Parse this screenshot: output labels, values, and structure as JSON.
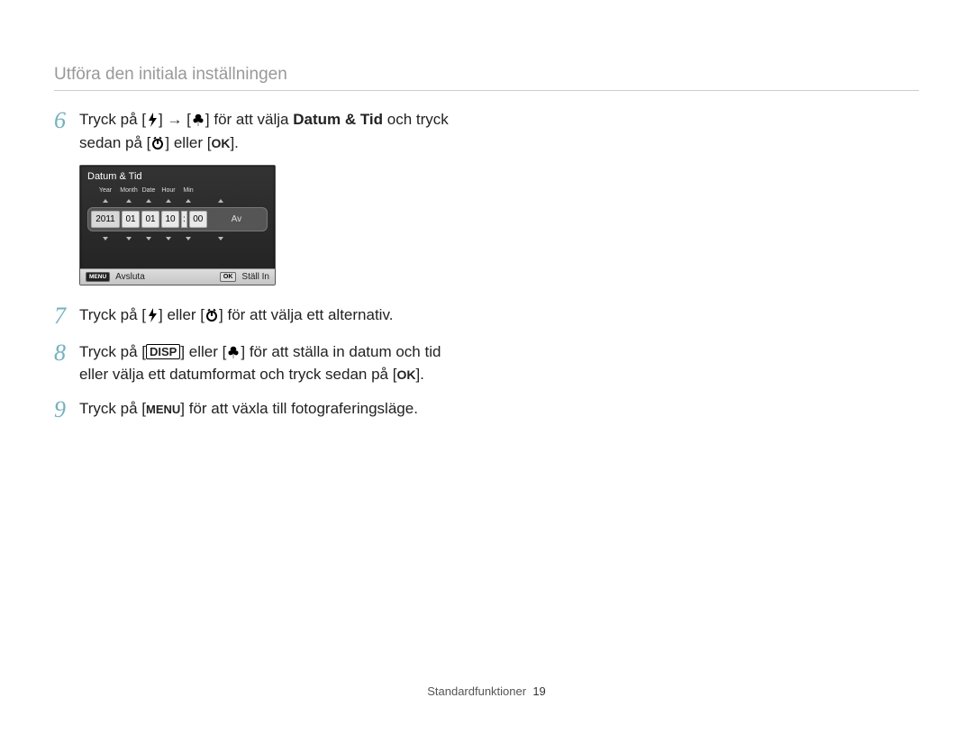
{
  "header": {
    "title": "Utföra den initiala inställningen"
  },
  "icons": {
    "flash": "flash-icon",
    "macro": "macro-icon",
    "timer": "self-timer-icon",
    "arrow_right": "→"
  },
  "steps": {
    "s6": {
      "num": "6",
      "t1": "Tryck på [",
      "t2": "] ",
      "t3": " [",
      "t4": "] för att välja ",
      "bold": "Datum & Tid",
      "t5": " och tryck",
      "t6": "sedan på [",
      "t7": "] eller [",
      "ok": "OK",
      "t8": "]."
    },
    "s7": {
      "num": "7",
      "t1": "Tryck på [",
      "t2": "] eller [",
      "t3": "] för att välja ett alternativ."
    },
    "s8": {
      "num": "8",
      "t1": "Tryck på [",
      "disp": "DISP",
      "t2": "] eller [",
      "t3": "] för att ställa in datum och tid",
      "t4": "eller välja ett datumformat och tryck sedan på [",
      "ok": "OK",
      "t5": "]."
    },
    "s9": {
      "num": "9",
      "t1": "Tryck på [",
      "menu": "MENU",
      "t2": "] för att växla till fotograferingsläge."
    }
  },
  "lcd": {
    "title": "Datum & Tid",
    "labels": {
      "year": "Year",
      "month": "Month",
      "date": "Date",
      "hour": "Hour",
      "min": "Min"
    },
    "values": {
      "year": "2011",
      "month": "01",
      "date": "01",
      "hour": "10",
      "min": "00",
      "av": "Av"
    },
    "footer": {
      "menu": "MENU",
      "exit": "Avsluta",
      "ok": "OK",
      "set": "Ställ In"
    }
  },
  "footer": {
    "section": "Standardfunktioner",
    "page": "19"
  }
}
